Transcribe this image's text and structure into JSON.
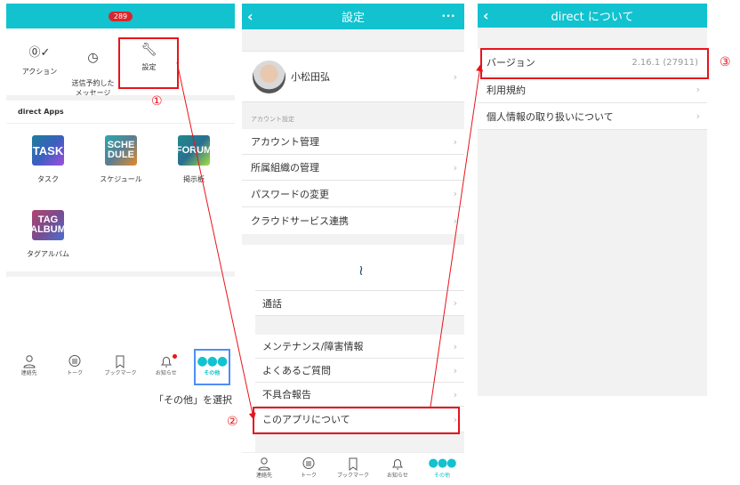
{
  "panel1": {
    "badge": "289",
    "actions": [
      {
        "label": "アクション"
      },
      {
        "label": "送信予約した\nメッセージ"
      },
      {
        "label": "設定"
      }
    ],
    "section_title": "direct Apps",
    "apps": [
      {
        "label": "タスク",
        "icon": "TASK",
        "color": "#1e7e9a"
      },
      {
        "label": "スケジュール",
        "icon": "SCHE\nDULE",
        "color": "#3a8f8f"
      },
      {
        "label": "掲示板",
        "icon": "FORUM",
        "color": "#1f8a8a"
      },
      {
        "label": "タグアルバム",
        "icon": "TAG\nALBUM",
        "color": "#a0456e"
      }
    ],
    "tabs": [
      {
        "label": "連絡先"
      },
      {
        "label": "トーク"
      },
      {
        "label": "ブックマーク"
      },
      {
        "label": "お知らせ"
      },
      {
        "label": "その他"
      }
    ]
  },
  "panel2": {
    "title": "設定",
    "user_name": "小松田弘",
    "section": "アカウント設定",
    "account_rows": [
      {
        "label": "アカウント管理"
      },
      {
        "label": "所属組織の管理"
      },
      {
        "label": "パスワードの変更"
      },
      {
        "label": "クラウドサービス連携"
      }
    ],
    "call_row": "通話",
    "info_rows": [
      {
        "label": "メンテナンス/障害情報"
      },
      {
        "label": "よくあるご質問"
      },
      {
        "label": "不具合報告"
      },
      {
        "label": "このアプリについて"
      }
    ],
    "tabs": [
      {
        "label": "連絡先"
      },
      {
        "label": "トーク"
      },
      {
        "label": "ブックマーク"
      },
      {
        "label": "お知らせ"
      },
      {
        "label": "その他"
      }
    ]
  },
  "panel3": {
    "title": "direct について",
    "version_label": "バージョン",
    "version_value": "2.16.1 (27911)",
    "rows": [
      {
        "label": "利用規約"
      },
      {
        "label": "個人情報の取り扱いについて"
      }
    ]
  },
  "annotations": {
    "step1": "①",
    "step2": "②",
    "step3": "③",
    "instruction": "「その他」を選択"
  },
  "colors": {
    "brand": "#12c2cf",
    "annotation": "#e8141b"
  }
}
